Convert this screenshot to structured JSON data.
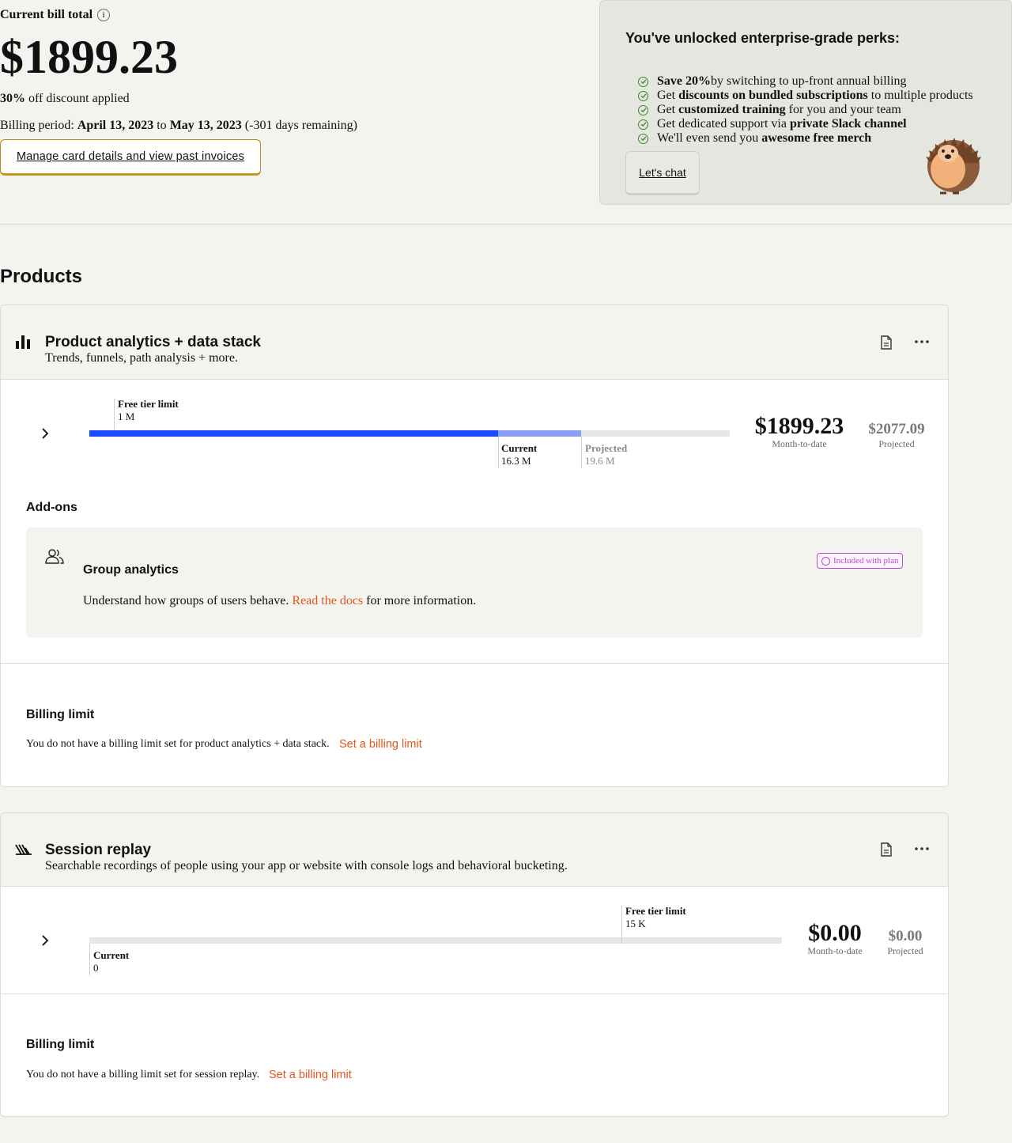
{
  "summary": {
    "bill_label": "Current bill total",
    "info_glyph": "i",
    "bill_amount": "$1899.23",
    "discount_bold": "30%",
    "discount_rest": " off discount applied",
    "period_prefix": "Billing period: ",
    "period_start": "April 13, 2023",
    "period_to": " to ",
    "period_end": "May 13, 2023",
    "period_remaining": " (-301 days remaining)",
    "manage_button": "Manage card details and view past invoices"
  },
  "perks": {
    "title": "You've unlocked enterprise-grade perks:",
    "items": [
      {
        "pre": "",
        "bold": "Save 20%",
        "post": " by switching to up-front annual billing"
      },
      {
        "pre": "Get ",
        "bold": "discounts on bundled subscriptions",
        "post": " to multiple products"
      },
      {
        "pre": "Get ",
        "bold": "customized training",
        "post": " for you and your team"
      },
      {
        "pre": "Get dedicated support via ",
        "bold": "private Slack channel",
        "post": ""
      },
      {
        "pre": "We'll even send you ",
        "bold": "awesome free merch",
        "post": ""
      }
    ],
    "chat_button": "Let's chat"
  },
  "products_title": "Products",
  "products": [
    {
      "name": "Product analytics + data stack",
      "description": "Trends, funnels, path analysis + more.",
      "icon": "bar-chart-icon",
      "free_tier_label": "Free tier limit",
      "free_tier_value": "1 M",
      "current_label": "Current",
      "current_value": "16.3 M",
      "projected_label": "Projected",
      "projected_value": "19.6 M",
      "usage_fraction_current": 0.638,
      "usage_fraction_projected": 0.768,
      "month_to_date": "$1899.23",
      "month_to_date_label": "Month-to-date",
      "projected_amount": "$2077.09",
      "projected_amount_label": "Projected",
      "addons_title": "Add-ons",
      "addon": {
        "name": "Group analytics",
        "desc_pre": "Understand how groups of users behave. ",
        "desc_link": "Read the docs",
        "desc_post": " for more information.",
        "badge": "Included with plan"
      },
      "billing_limit_title": "Billing limit",
      "billing_limit_text": "You do not have a billing limit set for product analytics + data stack.",
      "billing_limit_link": "Set a billing limit"
    },
    {
      "name": "Session replay",
      "description": "Searchable recordings of people using your app or website with console logs and behavioral bucketing.",
      "icon": "session-replay-icon",
      "free_tier_label": "Free tier limit",
      "free_tier_value": "15 K",
      "current_label": "Current",
      "current_value": "0",
      "month_to_date": "$0.00",
      "month_to_date_label": "Month-to-date",
      "projected_amount": "$0.00",
      "projected_amount_label": "Projected",
      "billing_limit_title": "Billing limit",
      "billing_limit_text": "You do not have a billing limit set for session replay.",
      "billing_limit_link": "Set a billing limit"
    }
  ],
  "colors": {
    "accent_orange": "#e0561c",
    "bar_current": "#1d4aff",
    "bar_projected": "#8a9ef5",
    "check_green": "#3a8a2a",
    "badge_purple": "#b454c8"
  }
}
